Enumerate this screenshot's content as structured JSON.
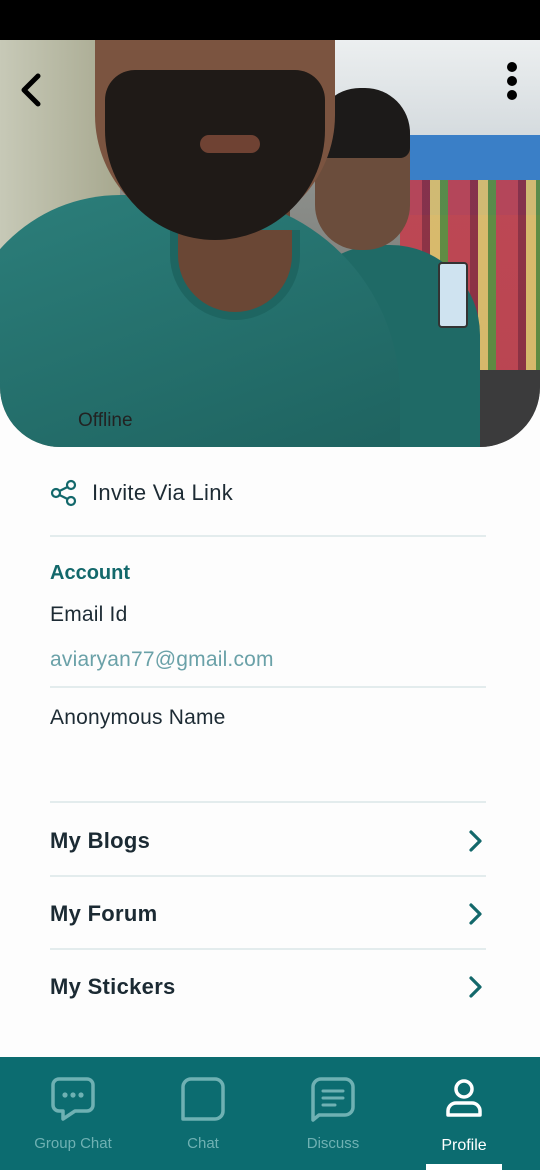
{
  "header": {
    "back_icon": "chevron-left-icon",
    "menu_icon": "more-vertical-icon"
  },
  "profile": {
    "status": "Offline"
  },
  "invite": {
    "icon": "share-icon",
    "label": "Invite Via Link"
  },
  "account": {
    "section_title": "Account",
    "email_label": "Email Id",
    "email_value": "aviaryan77@gmail.com",
    "anonymous_label": "Anonymous Name"
  },
  "links": [
    {
      "label": "My Blogs",
      "icon": "chevron-right-icon"
    },
    {
      "label": "My Forum",
      "icon": "chevron-right-icon"
    },
    {
      "label": "My Stickers",
      "icon": "chevron-right-icon"
    }
  ],
  "bottom_nav": [
    {
      "label": "Group Chat",
      "icon": "group-chat-icon",
      "active": false
    },
    {
      "label": "Chat",
      "icon": "chat-icon",
      "active": false
    },
    {
      "label": "Discuss",
      "icon": "discuss-icon",
      "active": false
    },
    {
      "label": "Profile",
      "icon": "profile-icon",
      "active": true
    }
  ],
  "colors": {
    "accent": "#13686b",
    "nav_background": "#0c6c70",
    "email_text": "#6aa1a8",
    "nav_inactive": "#6fb1b3"
  }
}
